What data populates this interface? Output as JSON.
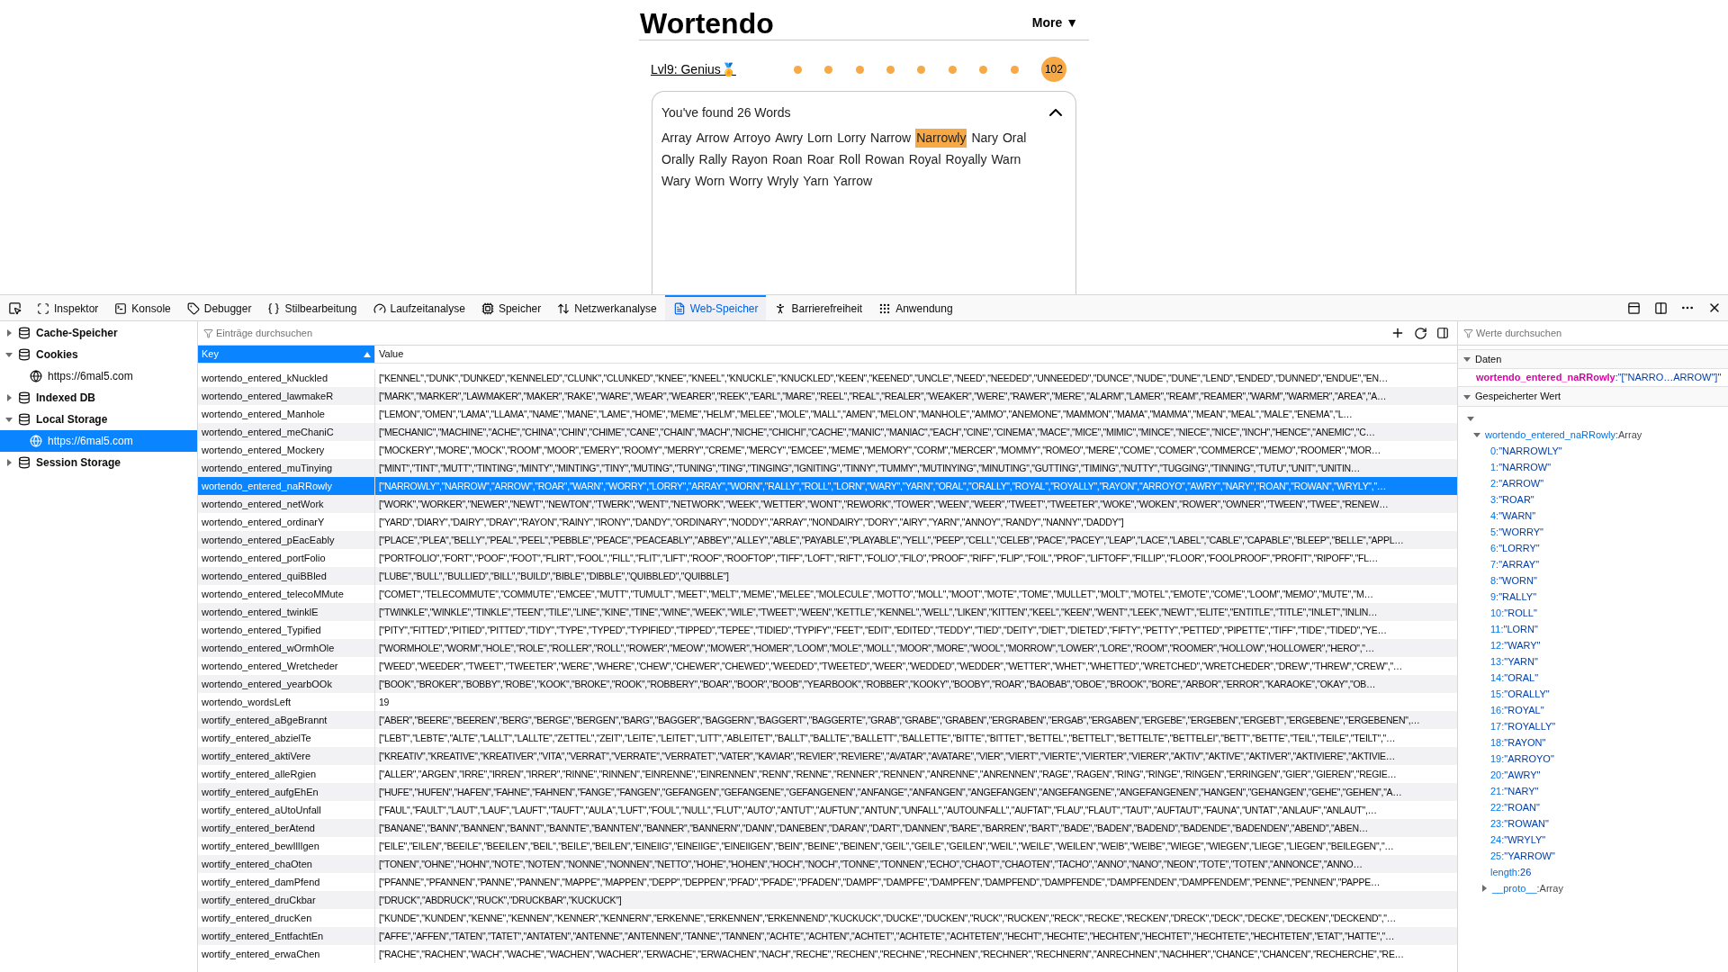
{
  "page": {
    "title": "Wortendo",
    "more_button": "More ▼",
    "level_link": "Lvl9: Genius🏅",
    "score": "102",
    "found_panel": {
      "heading": "You've found 26 Words",
      "expanded": true,
      "words": [
        {
          "text": "Array",
          "selected": false
        },
        {
          "text": "Arrow",
          "selected": false
        },
        {
          "text": "Arroyo",
          "selected": false
        },
        {
          "text": "Awry",
          "selected": false
        },
        {
          "text": "Lorn",
          "selected": false
        },
        {
          "text": "Lorry",
          "selected": false
        },
        {
          "text": "Narrow",
          "selected": false
        },
        {
          "text": "Narrowly",
          "selected": true
        },
        {
          "text": "Nary",
          "selected": false
        },
        {
          "text": "Oral",
          "selected": false
        },
        {
          "text": "Orally",
          "selected": false
        },
        {
          "text": "Rally",
          "selected": false
        },
        {
          "text": "Rayon",
          "selected": false
        },
        {
          "text": "Roan",
          "selected": false
        },
        {
          "text": "Roar",
          "selected": false
        },
        {
          "text": "Roll",
          "selected": false
        },
        {
          "text": "Rowan",
          "selected": false
        },
        {
          "text": "Royal",
          "selected": false
        },
        {
          "text": "Royally",
          "selected": false
        },
        {
          "text": "Warn",
          "selected": false
        },
        {
          "text": "Wary",
          "selected": false
        },
        {
          "text": "Worn",
          "selected": false
        },
        {
          "text": "Worry",
          "selected": false
        },
        {
          "text": "Wryly",
          "selected": false
        },
        {
          "text": "Yarn",
          "selected": false
        },
        {
          "text": "Yarrow",
          "selected": false
        }
      ]
    }
  },
  "devtools": {
    "tabs": [
      {
        "label": "Inspektor",
        "selected": false
      },
      {
        "label": "Konsole",
        "selected": false
      },
      {
        "label": "Debugger",
        "selected": false
      },
      {
        "label": "Stilbearbeitung",
        "selected": false
      },
      {
        "label": "Laufzeitanalyse",
        "selected": false
      },
      {
        "label": "Speicher",
        "selected": false
      },
      {
        "label": "Netzwerkanalyse",
        "selected": false
      },
      {
        "label": "Web-Speicher",
        "selected": true
      },
      {
        "label": "Barrierefreiheit",
        "selected": false
      },
      {
        "label": "Anwendung",
        "selected": false
      }
    ],
    "sidebar": {
      "items": [
        {
          "label": "Cache-Speicher",
          "expanded": false
        },
        {
          "label": "Cookies",
          "expanded": true,
          "children": [
            {
              "label": "https://6mal5.com",
              "selected": false
            }
          ]
        },
        {
          "label": "Indexed DB",
          "expanded": false
        },
        {
          "label": "Local Storage",
          "expanded": true,
          "children": [
            {
              "label": "https://6mal5.com",
              "selected": true
            }
          ]
        },
        {
          "label": "Session Storage",
          "expanded": false
        }
      ]
    },
    "table": {
      "filter_placeholder": "Einträge durchsuchen",
      "columns": [
        "Key",
        "Value"
      ],
      "rows": [
        {
          "key": "wortendo_entered_kNuckled",
          "value": "[\"KENNEL\",\"DUNK\",\"DUNKED\",\"KENNELED\",\"CLUNK\",\"CLUNKED\",\"KNEE\",\"KNEEL\",\"KNUCKLE\",\"KNUCKLED\",\"KEEN\",\"KEENED\",\"UNCLE\",\"NEED\",\"NEEDED\",\"UNNEEDED\",\"DUNCE\",\"NUDE\",\"DUNE\",\"LEND\",\"ENDED\",\"DUNNED\",\"ENDUE\",\"EN…",
          "selected": false
        },
        {
          "key": "wortendo_entered_lawmakeR",
          "value": "[\"MARK\",\"MARKER\",\"LAWMAKER\",\"MAKER\",\"RAKE\",\"WARE\",\"WEAR\",\"WEARER\",\"REEK\",\"EARL\",\"MARE\",\"REEL\",\"REAL\",\"REALER\",\"WEAKER\",\"WERE\",\"RAWER\",\"MERE\",\"ALARM\",\"LAMER\",\"REAM\",\"REAMER\",\"WARM\",\"WARMER\",\"AREA\",\"A…",
          "selected": false
        },
        {
          "key": "wortendo_entered_Manhole",
          "value": "[\"LEMON\",\"OMEN\",\"LAMA\",\"LLAMA\",\"NAME\",\"MANE\",\"LAME\",\"HOME\",\"MEME\",\"HELM\",\"MELEE\",\"MOLE\",\"MALL\",\"AMEN\",\"MELON\",\"MANHOLE\",\"AMMO\",\"ANEMONE\",\"MAMMON\",\"MAMA\",\"MAMMA\",\"MEAN\",\"MEAL\",\"MALE\",\"ENEMA\",\"L…",
          "selected": false
        },
        {
          "key": "wortendo_entered_meChaniC",
          "value": "[\"MECHANIC\",\"MACHINE\",\"ACHE\",\"CHINA\",\"CHIN\",\"CHIME\",\"CANE\",\"CHAIN\",\"MACH\",\"NICHE\",\"CHICHI\",\"CACHE\",\"MANIC\",\"MANIAC\",\"EACH\",\"CINE\",\"CINEMA\",\"MACE\",\"MICE\",\"MIMIC\",\"MINCE\",\"NIECE\",\"NICE\",\"INCH\",\"HENCE\",\"ANEMIC\",\"C…",
          "selected": false
        },
        {
          "key": "wortendo_entered_Mockery",
          "value": "[\"MOCKERY\",\"MORE\",\"MOCK\",\"ROOM\",\"MOOR\",\"EMERY\",\"ROOMY\",\"MERRY\",\"CREME\",\"MERCY\",\"EMCEE\",\"MEME\",\"MEMORY\",\"CORM\",\"MERCER\",\"MOMMY\",\"ROMEO\",\"MERE\",\"COME\",\"COMER\",\"COMMERCE\",\"MEMO\",\"ROOMER\",\"MOR…",
          "selected": false
        },
        {
          "key": "wortendo_entered_muTinying",
          "value": "[\"MINT\",\"TINT\",\"MUTT\",\"TINTING\",\"MINTY\",\"MINTING\",\"TINY\",\"MUTING\",\"TUNING\",\"TING\",\"TINGING\",\"IGNITING\",\"TINNY\",\"TUMMY\",\"MUTINYING\",\"MINUTING\",\"GUTTING\",\"TIMING\",\"NUTTY\",\"TUGGING\",\"TINNING\",\"TUTU\",\"UNIT\",\"UNITIN…",
          "selected": false
        },
        {
          "key": "wortendo_entered_naRRowly",
          "value": "[\"NARROWLY\",\"NARROW\",\"ARROW\",\"ROAR\",\"WARN\",\"WORRY\",\"LORRY\",\"ARRAY\",\"WORN\",\"RALLY\",\"ROLL\",\"LORN\",\"WARY\",\"YARN\",\"ORAL\",\"ORALLY\",\"ROYAL\",\"ROYALLY\",\"RAYON\",\"ARROYO\",\"AWRY\",\"NARY\",\"ROAN\",\"ROWAN\",\"WRYLY\",\"…",
          "selected": true
        },
        {
          "key": "wortendo_entered_netWork",
          "value": "[\"WORK\",\"WORKER\",\"NEWER\",\"NEWT\",\"NEWTON\",\"TWERK\",\"WENT\",\"NETWORK\",\"WEEK\",\"WETTER\",\"WONT\",\"REWORK\",\"TOWER\",\"WEEN\",\"WEER\",\"TWEET\",\"TWEETER\",\"WOKE\",\"WOKEN\",\"ROWER\",\"OWNER\",\"TWEEN\",\"TWEE\",\"RENEW…",
          "selected": false
        },
        {
          "key": "wortendo_entered_ordinarY",
          "value": "[\"YARD\",\"DIARY\",\"DAIRY\",\"DRAY\",\"RAYON\",\"RAINY\",\"IRONY\",\"DANDY\",\"ORDINARY\",\"NODDY\",\"ARRAY\",\"NONDAIRY\",\"DORY\",\"AIRY\",\"YARN\",\"ANNOY\",\"RANDY\",\"NANNY\",\"DADDY\"]",
          "selected": false
        },
        {
          "key": "wortendo_entered_pEacEably",
          "value": "[\"PLACE\",\"PLEA\",\"BELLY\",\"PEAL\",\"PEEL\",\"PEBBLE\",\"PEACE\",\"PEACEABLY\",\"ABBEY\",\"ALLEY\",\"ABLE\",\"PAYABLE\",\"PLAYABLE\",\"YELL\",\"PEEP\",\"CELL\",\"CELEB\",\"PACE\",\"PACEY\",\"LEAP\",\"LACE\",\"LABEL\",\"CABLE\",\"CAPABLE\",\"BLEEP\",\"BELLE\",\"APPL…",
          "selected": false
        },
        {
          "key": "wortendo_entered_portFolio",
          "value": "[\"PORTFOLIO\",\"FORT\",\"POOF\",\"FOOT\",\"FLIRT\",\"FOOL\",\"FILL\",\"FLIT\",\"LIFT\",\"ROOF\",\"ROOFTOP\",\"TIFF\",\"LOFT\",\"RIFT\",\"FOLIO\",\"FILO\",\"PROOF\",\"RIFF\",\"FLIP\",\"FOIL\",\"PROF\",\"LIFTOFF\",\"FILLIP\",\"FLOOR\",\"FOOLPROOF\",\"PROFIT\",\"RIPOFF\",\"FL…",
          "selected": false
        },
        {
          "key": "wortendo_entered_quiBBled",
          "value": "[\"LUBE\",\"BULL\",\"BULLIED\",\"BILL\",\"BUILD\",\"BIBLE\",\"DIBBLE\",\"QUIBBLED\",\"QUIBBLE\"]",
          "selected": false
        },
        {
          "key": "wortendo_entered_telecoMMute",
          "value": "[\"COMET\",\"TELECOMMUTE\",\"COMMUTE\",\"EMCEE\",\"MUTT\",\"TUMULT\",\"MEET\",\"MELT\",\"MEME\",\"MELEE\",\"MOLECULE\",\"MOTTO\",\"MOLL\",\"MOOT\",\"MOTE\",\"TOME\",\"MULLET\",\"MOLT\",\"MOTEL\",\"EMOTE\",\"COME\",\"LOOM\",\"MEMO\",\"MUTE\",\"M…",
          "selected": false
        },
        {
          "key": "wortendo_entered_twinklE",
          "value": "[\"TWINKLE\",\"WINKLE\",\"TINKLE\",\"TEEN\",\"TILE\",\"LINE\",\"KINE\",\"TINE\",\"WINE\",\"WEEK\",\"WILE\",\"TWEET\",\"WEEN\",\"KETTLE\",\"KENNEL\",\"WELL\",\"LIKEN\",\"KITTEN\",\"KEEL\",\"KEEN\",\"WENT\",\"LEEK\",\"NEWT\",\"ELITE\",\"ENTITLE\",\"TITLE\",\"INLET\",\"INLIN…",
          "selected": false
        },
        {
          "key": "wortendo_entered_Typified",
          "value": "[\"PITY\",\"FITTED\",\"PITIED\",\"PITTED\",\"TIDY\",\"TYPE\",\"TYPED\",\"TYPIFIED\",\"TIPPED\",\"TEPEE\",\"TIDIED\",\"TYPIFY\",\"FEET\",\"EDIT\",\"EDITED\",\"TEDDY\",\"TIED\",\"DEITY\",\"DIET\",\"DIETED\",\"FIFTY\",\"PETTY\",\"PETTED\",\"PIPETTE\",\"TIFF\",\"TIDE\",\"TIDED\",\"YE…",
          "selected": false
        },
        {
          "key": "wortendo_entered_wOrmhOle",
          "value": "[\"WORMHOLE\",\"WORM\",\"HOLE\",\"ROLE\",\"ROLLER\",\"ROLL\",\"ROWER\",\"MEOW\",\"MOWER\",\"HOMER\",\"LOOM\",\"MOLE\",\"MOLL\",\"MOOR\",\"MORE\",\"WOOL\",\"MORROW\",\"LOWER\",\"LORE\",\"ROOM\",\"ROOMER\",\"HOLLOW\",\"HOLLOWER\",\"HERO\",\"…",
          "selected": false
        },
        {
          "key": "wortendo_entered_Wretcheder",
          "value": "[\"WEED\",\"WEEDER\",\"TWEET\",\"TWEETER\",\"WERE\",\"WHERE\",\"CHEW\",\"CHEWER\",\"CHEWED\",\"WEEDED\",\"TWEETED\",\"WEER\",\"WEDDED\",\"WEDDER\",\"WETTER\",\"WHET\",\"WHETTED\",\"WRETCHED\",\"WRETCHEDER\",\"DREW\",\"THREW\",\"CREW\",\"…",
          "selected": false
        },
        {
          "key": "wortendo_entered_yearbOOk",
          "value": "[\"BOOK\",\"BROKER\",\"BOBBY\",\"ROBE\",\"KOOK\",\"BROKE\",\"ROOK\",\"ROBBERY\",\"BOAR\",\"BOOR\",\"BOOB\",\"YEARBOOK\",\"ROBBER\",\"KOOKY\",\"BOOBY\",\"ROAR\",\"BAOBAB\",\"OBOE\",\"BROOK\",\"BORE\",\"ARBOR\",\"ERROR\",\"KARAOKE\",\"OKAY\",\"OB…",
          "selected": false
        },
        {
          "key": "wortendo_wordsLeft",
          "value": "19",
          "selected": false
        },
        {
          "key": "wortify_entered_aBgeBrannt",
          "value": "[\"ABER\",\"BEERE\",\"BEEREN\",\"BERG\",\"BERGE\",\"BERGEN\",\"BARG\",\"BAGGER\",\"BAGGERN\",\"BAGGERT\",\"BAGGERTE\",\"GRAB\",\"GRABE\",\"GRABEN\",\"ERGRABEN\",\"ERGAB\",\"ERGABEN\",\"ERGEBE\",\"ERGEBEN\",\"ERGEBT\",\"ERGEBENE\",\"ERGEBENEN\",…",
          "selected": false
        },
        {
          "key": "wortify_entered_abzielTe",
          "value": "[\"LEBT\",\"LEBTE\",\"ALTE\",\"LALLT\",\"LALLTE\",\"ZETTEL\",\"ZEIT\",\"LEITE\",\"LEITET\",\"LITT\",\"ABLEITET\",\"BALLT\",\"BALLTE\",\"BALLETT\",\"BALLETTE\",\"BITTE\",\"BITTET\",\"BETTEL\",\"BETTELT\",\"BETTELTE\",\"BETTELEI\",\"BETT\",\"BETTE\",\"TEIL\",\"TEILE\",\"TEILT\",\"…",
          "selected": false
        },
        {
          "key": "wortify_entered_aktiVere",
          "value": "[\"KREATIV\",\"KREATIVE\",\"KREATIVER\",\"VITA\",\"VERRAT\",\"VERRATE\",\"VERRATET\",\"VATER\",\"KAVIAR\",\"REVIER\",\"REVIERE\",\"AVATAR\",\"AVATARE\",\"VIER\",\"VIERT\",\"VIERTE\",\"VIERTER\",\"VIERER\",\"AKTIV\",\"AKTIVE\",\"AKTIVER\",\"AKTIVIERE\",\"AKTIVIE…",
          "selected": false
        },
        {
          "key": "wortify_entered_alleRgien",
          "value": "[\"ALLER\",\"ARGEN\",\"IRRE\",\"IRREN\",\"IRRER\",\"RINNE\",\"RINNEN\",\"EINRENNE\",\"EINRENNEN\",\"RENN\",\"RENNE\",\"RENNER\",\"RENNEN\",\"ANRENNE\",\"ANRENNEN\",\"RAGE\",\"RAGEN\",\"RING\",\"RINGE\",\"RINGEN\",\"ERRINGEN\",\"GIER\",\"GIEREN\",\"REGIE…",
          "selected": false
        },
        {
          "key": "wortify_entered_aufgEhEn",
          "value": "[\"HUFE\",\"HUFEN\",\"HAFEN\",\"FAHNE\",\"FAHNEN\",\"FANGE\",\"FANGEN\",\"GEFANGEN\",\"GEFANGENE\",\"GEFANGENEN\",\"ANFANGE\",\"ANFANGEN\",\"ANGEFANGEN\",\"ANGEFANGENE\",\"ANGEFANGENEN\",\"HANGEN\",\"GEHANGEN\",\"GEHE\",\"GEHEN\",\"A…",
          "selected": false
        },
        {
          "key": "wortify_entered_aUtoUnfall",
          "value": "[\"FAUL\",\"FAULT\",\"LAUT\",\"LAUF\",\"LAUFT\",\"TAUFT\",\"AULA\",\"LUFT\",\"FOUL\",\"NULL\",\"FLUT\",\"AUTO\",\"ANTUT\",\"AUFTUN\",\"ANTUN\",\"UNFALL\",\"AUTOUNFALL\",\"AUFTAT\",\"FLAU\",\"FLAUT\",\"TAUT\",\"AUFTAUT\",\"FAUNA\",\"UNTAT\",\"ANLAUF\",\"ANLAUT\",…",
          "selected": false
        },
        {
          "key": "wortify_entered_berAtend",
          "value": "[\"BANANE\",\"BANN\",\"BANNEN\",\"BANNT\",\"BANNTE\",\"BANNTEN\",\"BANNER\",\"BANNERN\",\"DANN\",\"DANEBEN\",\"DARAN\",\"DART\",\"DANNEN\",\"BARE\",\"BARREN\",\"BART\",\"BADE\",\"BADEN\",\"BADEND\",\"BADENDE\",\"BADENDEN\",\"ABEND\",\"ABEN…",
          "selected": false
        },
        {
          "key": "wortify_entered_bewIllIgen",
          "value": "[\"EILE\",\"EILEN\",\"BEEILE\",\"BEEILEN\",\"BEIL\",\"BEILE\",\"BEILEN\",\"EINEIIG\",\"EINEIIGE\",\"EINEIIGEN\",\"BEIN\",\"BEINE\",\"BEINEN\",\"GEIL\",\"GEILE\",\"GEILEN\",\"WEIL\",\"WEILE\",\"WEILEN\",\"WEIB\",\"WEIBE\",\"WIEGE\",\"WIEGEN\",\"LIEGE\",\"LIEGEN\",\"BEILEGEN\",\"…",
          "selected": false
        },
        {
          "key": "wortify_entered_chaOten",
          "value": "[\"TONEN\",\"OHNE\",\"HOHN\",\"NOTE\",\"NOTEN\",\"NONNE\",\"NONNEN\",\"NETTO\",\"HOHE\",\"HOHEN\",\"HOCH\",\"NOCH\",\"TONNE\",\"TONNEN\",\"ECHO\",\"CHAOT\",\"CHAOTEN\",\"TACHO\",\"ANNO\",\"NANO\",\"NEON\",\"TOTE\",\"TOTEN\",\"ANNONCE\",\"ANNO…",
          "selected": false
        },
        {
          "key": "wortify_entered_damPfend",
          "value": "[\"PFANNE\",\"PFANNEN\",\"PANNE\",\"PANNEN\",\"MAPPE\",\"MAPPEN\",\"DEPP\",\"DEPPEN\",\"PFAD\",\"PFADE\",\"PFADEN\",\"DAMPF\",\"DAMPFE\",\"DAMPFEN\",\"DAMPFEND\",\"DAMPFENDE\",\"DAMPFENDEN\",\"DAMPFENDEM\",\"PENNE\",\"PENNEN\",\"PAPPE…",
          "selected": false
        },
        {
          "key": "wortify_entered_druCkbar",
          "value": "[\"DRUCK\",\"ABDRUCK\",\"RUCK\",\"DRUCKBAR\",\"KUCKUCK\"]",
          "selected": false
        },
        {
          "key": "wortify_entered_drucKen",
          "value": "[\"KUNDE\",\"KUNDEN\",\"KENNE\",\"KENNEN\",\"KENNER\",\"KENNERN\",\"ERKENNE\",\"ERKENNEN\",\"ERKENNEND\",\"KUCKUCK\",\"DUCKE\",\"DUCKEN\",\"RUCK\",\"RUCKEN\",\"RECK\",\"RECKE\",\"RECKEN\",\"DRECK\",\"DECK\",\"DECKE\",\"DECKEN\",\"DECKEND\",\"…",
          "selected": false
        },
        {
          "key": "wortify_entered_EntfachtEn",
          "value": "[\"AFFE\",\"AFFEN\",\"TATEN\",\"TATET\",\"ANTATEN\",\"ANTENNE\",\"ANTENNEN\",\"TANNE\",\"TANNEN\",\"ACHTE\",\"ACHTEN\",\"ACHTET\",\"ACHTETE\",\"ACHTETEN\",\"HECHT\",\"HECHTE\",\"HECHTEN\",\"HECHTET\",\"HECHTETE\",\"HECHTETEN\",\"ETAT\",\"HATTE\",\"…",
          "selected": false
        },
        {
          "key": "wortify_entered_erwaChen",
          "value": "[\"RACHE\",\"RACHEN\",\"WACH\",\"WACHE\",\"WACHEN\",\"WACHER\",\"ERWACHE\",\"ERWACHEN\",\"NACH\",\"RECHE\",\"RECHEN\",\"RECHNE\",\"RECHNEN\",\"RECHNER\",\"RECHNERN\",\"ANRECHNEN\",\"NACHHER\",\"CHANCE\",\"CHANCEN\",\"RECHERCHE\",\"RE…",
          "selected": false
        }
      ]
    },
    "details": {
      "filter_placeholder": "Werte durchsuchen",
      "data_section": {
        "title": "Daten",
        "expanded": true,
        "key": "wortendo_entered_naRRowly",
        "value": ":\"[\"NARRO…ARROW\"]\""
      },
      "stored_section": {
        "title": "Gespeicherter Wert",
        "expanded": true,
        "root": {
          "expanded": true,
          "children": [
            {
              "label": "wortendo_entered_naRRowly",
              "type": ":Array",
              "expanded": true,
              "children": [
                {
                  "kind": "entry",
                  "index": "0:",
                  "value": "\"NARROWLY\""
                },
                {
                  "kind": "entry",
                  "index": "1:",
                  "value": "\"NARROW\""
                },
                {
                  "kind": "entry",
                  "index": "2:",
                  "value": "\"ARROW\""
                },
                {
                  "kind": "entry",
                  "index": "3:",
                  "value": "\"ROAR\""
                },
                {
                  "kind": "entry",
                  "index": "4:",
                  "value": "\"WARN\""
                },
                {
                  "kind": "entry",
                  "index": "5:",
                  "value": "\"WORRY\""
                },
                {
                  "kind": "entry",
                  "index": "6:",
                  "value": "\"LORRY\""
                },
                {
                  "kind": "entry",
                  "index": "7:",
                  "value": "\"ARRAY\""
                },
                {
                  "kind": "entry",
                  "index": "8:",
                  "value": "\"WORN\""
                },
                {
                  "kind": "entry",
                  "index": "9:",
                  "value": "\"RALLY\""
                },
                {
                  "kind": "entry",
                  "index": "10:",
                  "value": "\"ROLL\""
                },
                {
                  "kind": "entry",
                  "index": "11:",
                  "value": "\"LORN\""
                },
                {
                  "kind": "entry",
                  "index": "12:",
                  "value": "\"WARY\""
                },
                {
                  "kind": "entry",
                  "index": "13:",
                  "value": "\"YARN\""
                },
                {
                  "kind": "entry",
                  "index": "14:",
                  "value": "\"ORAL\""
                },
                {
                  "kind": "entry",
                  "index": "15:",
                  "value": "\"ORALLY\""
                },
                {
                  "kind": "entry",
                  "index": "16:",
                  "value": "\"ROYAL\""
                },
                {
                  "kind": "entry",
                  "index": "17:",
                  "value": "\"ROYALLY\""
                },
                {
                  "kind": "entry",
                  "index": "18:",
                  "value": "\"RAYON\""
                },
                {
                  "kind": "entry",
                  "index": "19:",
                  "value": "\"ARROYO\""
                },
                {
                  "kind": "entry",
                  "index": "20:",
                  "value": "\"AWRY\""
                },
                {
                  "kind": "entry",
                  "index": "21:",
                  "value": "\"NARY\""
                },
                {
                  "kind": "entry",
                  "index": "22:",
                  "value": "\"ROAN\""
                },
                {
                  "kind": "entry",
                  "index": "23:",
                  "value": "\"ROWAN\""
                },
                {
                  "kind": "entry",
                  "index": "24:",
                  "value": "\"WRYLY\""
                },
                {
                  "kind": "entry",
                  "index": "25:",
                  "value": "\"YARROW\""
                },
                {
                  "kind": "entry",
                  "index": "length:",
                  "value": "26"
                },
                {
                  "kind": "node",
                  "label": "__proto__",
                  "type": ":Array",
                  "expanded": false
                }
              ]
            }
          ]
        }
      }
    }
  }
}
